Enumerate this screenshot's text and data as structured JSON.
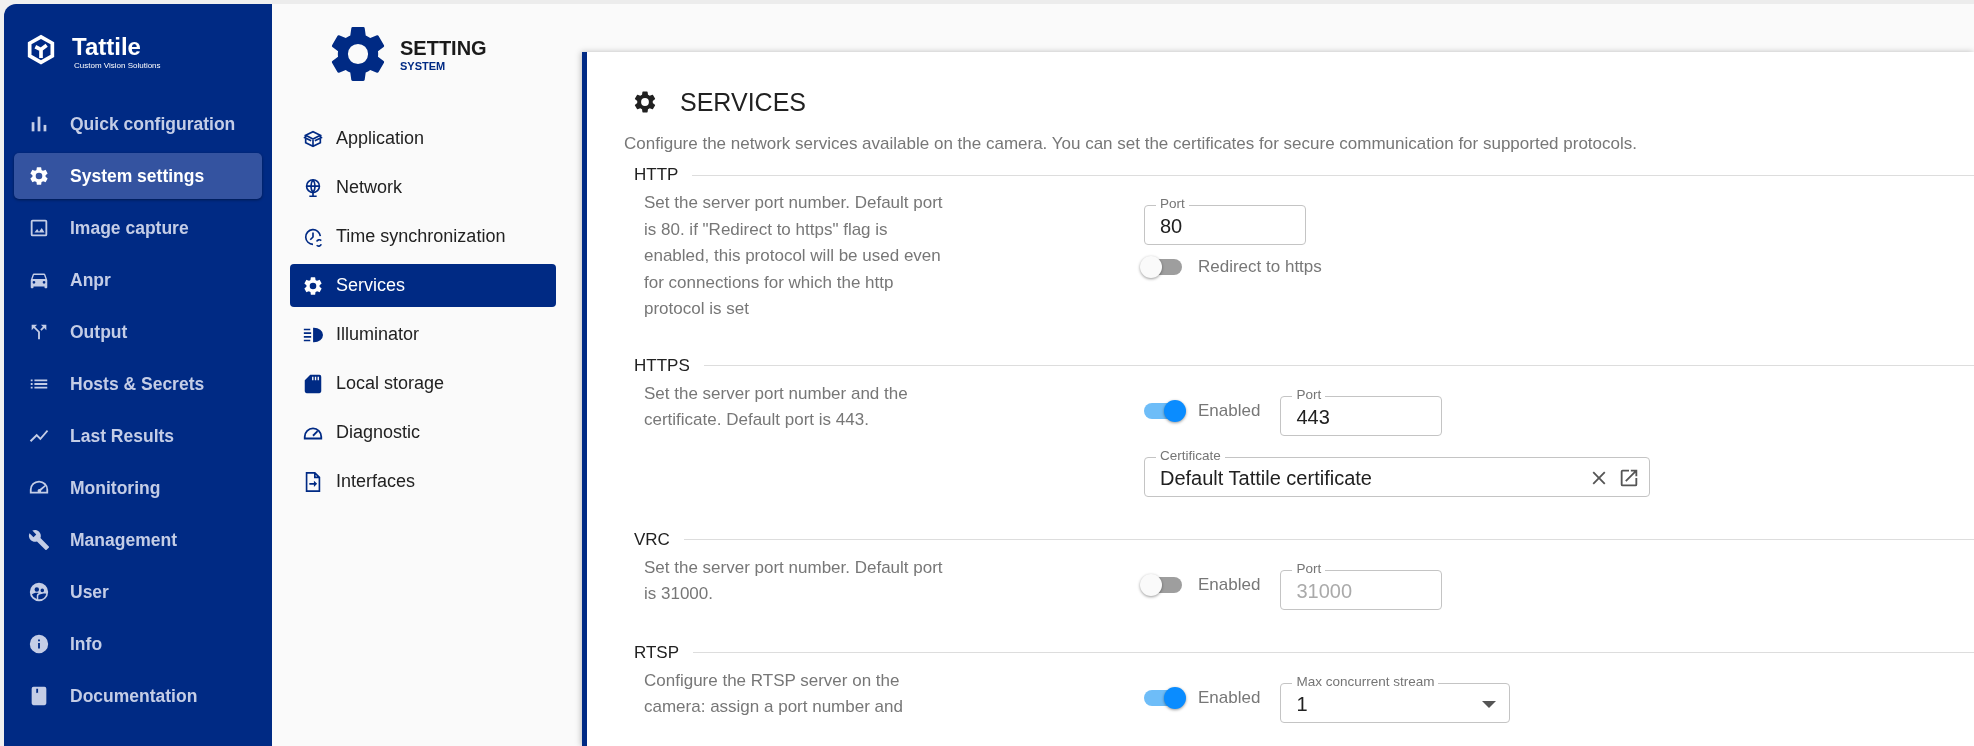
{
  "sidebar": {
    "brand": {
      "name": "Tattile",
      "tagline": "Custom Vision Solutions"
    },
    "items": [
      {
        "label": "Quick configuration",
        "selected": false
      },
      {
        "label": "System settings",
        "selected": true
      },
      {
        "label": "Image capture",
        "selected": false
      },
      {
        "label": "Anpr",
        "selected": false
      },
      {
        "label": "Output",
        "selected": false
      },
      {
        "label": "Hosts & Secrets",
        "selected": false
      },
      {
        "label": "Last Results",
        "selected": false
      },
      {
        "label": "Monitoring",
        "selected": false
      },
      {
        "label": "Management",
        "selected": false
      },
      {
        "label": "User",
        "selected": false
      },
      {
        "label": "Info",
        "selected": false
      },
      {
        "label": "Documentation",
        "selected": false
      }
    ]
  },
  "submenu": {
    "title": "SETTING",
    "subtitle": "SYSTEM",
    "items": [
      {
        "label": "Application",
        "selected": false
      },
      {
        "label": "Network",
        "selected": false
      },
      {
        "label": "Time synchronization",
        "selected": false
      },
      {
        "label": "Services",
        "selected": true
      },
      {
        "label": "Illuminator",
        "selected": false
      },
      {
        "label": "Local storage",
        "selected": false
      },
      {
        "label": "Diagnostic",
        "selected": false
      },
      {
        "label": "Interfaces",
        "selected": false
      }
    ]
  },
  "panel": {
    "title": "SERVICES",
    "description": "Configure the network services available on the camera. You can set the certificates for secure communication for supported protocols.",
    "sections": [
      {
        "name": "HTTP",
        "description": "Set the server port number. Default port is 80. if \"Redirect to https\" flag is enabled, this protocol will be used even for connections for which the http protocol is set",
        "rows": [
          [
            {
              "kind": "field",
              "label": "Port",
              "value": "80",
              "disabled": false
            }
          ],
          [
            {
              "kind": "switch",
              "label": "Redirect to https",
              "on": false
            }
          ]
        ]
      },
      {
        "name": "HTTPS",
        "description": "Set the server port number and the certificate. Default port is 443.",
        "rows": [
          [
            {
              "kind": "switch",
              "label": "Enabled",
              "on": true
            },
            {
              "kind": "field",
              "label": "Port",
              "value": "443",
              "disabled": false
            }
          ],
          [
            {
              "kind": "picker",
              "label": "Certificate",
              "value": "Default Tattile certificate"
            }
          ]
        ]
      },
      {
        "name": "VRC",
        "description": "Set the server port number. Default port is 31000.",
        "rows": [
          [
            {
              "kind": "switch",
              "label": "Enabled",
              "on": false
            },
            {
              "kind": "field",
              "label": "Port",
              "value": "31000",
              "disabled": true
            }
          ]
        ]
      },
      {
        "name": "RTSP",
        "description": "Configure the RTSP server on the camera: assign a port number and",
        "rows": [
          [
            {
              "kind": "switch",
              "label": "Enabled",
              "on": true
            },
            {
              "kind": "select",
              "label": "Max concurrent stream",
              "value": "1"
            }
          ]
        ]
      }
    ]
  }
}
